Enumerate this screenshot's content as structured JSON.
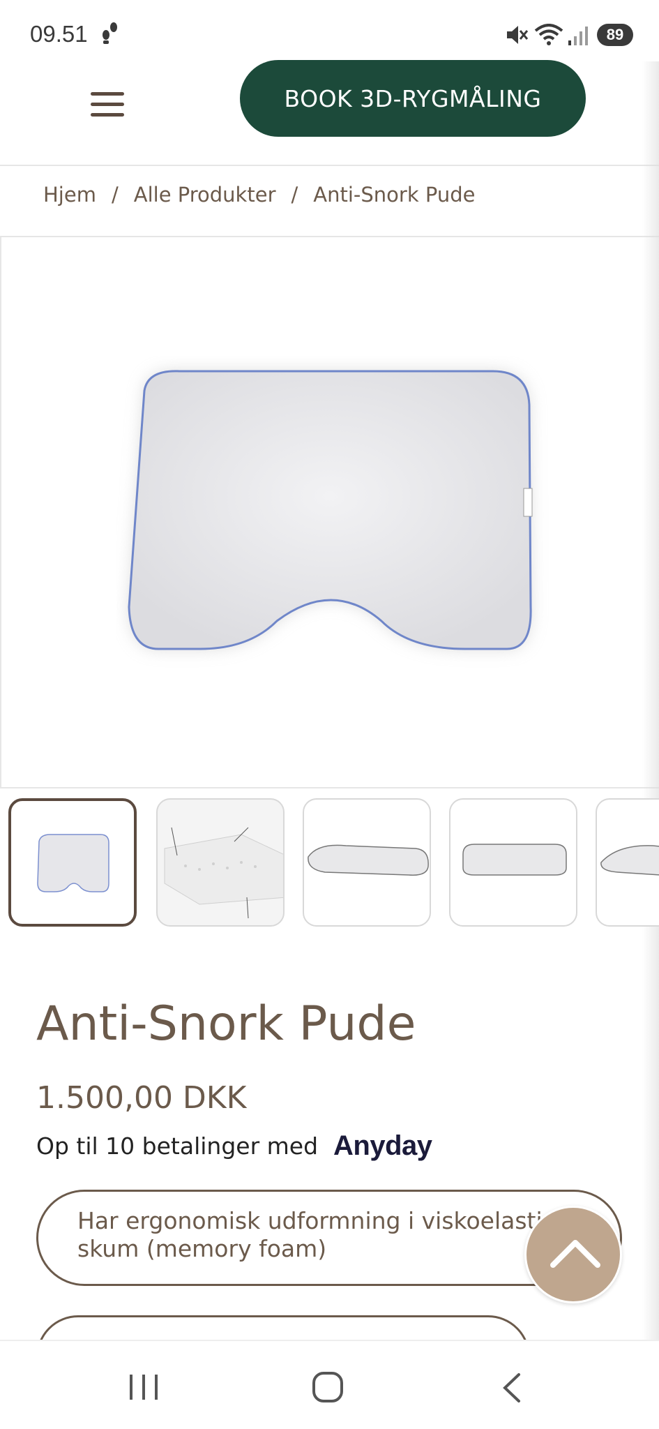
{
  "status_bar": {
    "time": "09.51",
    "battery": "89",
    "icons": [
      "footsteps-icon",
      "mute-icon",
      "wifi-icon",
      "signal-icon"
    ]
  },
  "header": {
    "menu_icon": "hamburger-icon",
    "book_button": "BOOK 3D-RYGMÅLING",
    "button_color": "#1c4a3a"
  },
  "breadcrumb": {
    "items": [
      "Hjem",
      "Alle Produkter",
      "Anti-Snork Pude"
    ],
    "separator": "/"
  },
  "gallery": {
    "main_image": "pillow-photo",
    "thumbnails": [
      {
        "label": "pillow-front"
      },
      {
        "label": "pillow-features-diagram"
      },
      {
        "label": "pillow-side"
      },
      {
        "label": "pillow-side-flat"
      },
      {
        "label": "pillow-angle"
      }
    ],
    "active_index": 0
  },
  "product": {
    "title": "Anti-Snork Pude",
    "price": "1.500,00 DKK",
    "installments_text": "Op til 10 betalinger med",
    "installments_brand": "Anyday",
    "features": [
      "Har ergonomisk udformning i viskoelastisk skum (memory foam)",
      ""
    ]
  },
  "scroll_top_icon": "chevron-up-icon",
  "accent_color": "#bfa68e",
  "text_color": "#6b5a4b",
  "nav_bar": {
    "icons": [
      "recent-apps-icon",
      "home-icon",
      "back-icon"
    ]
  }
}
